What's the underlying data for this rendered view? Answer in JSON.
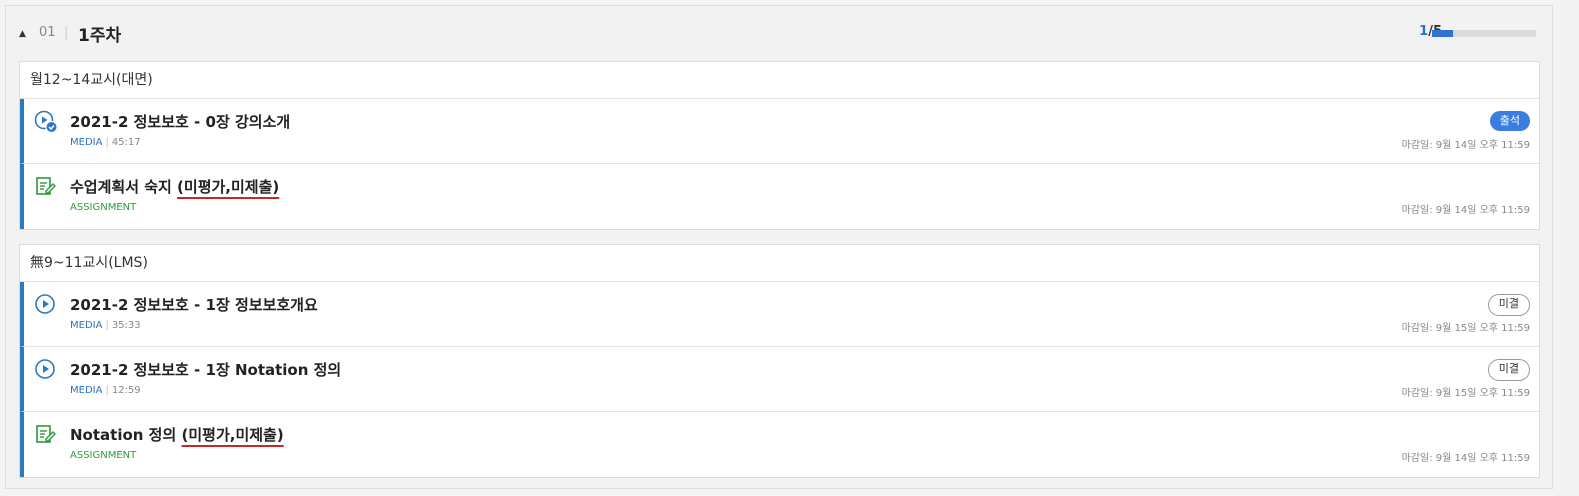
{
  "week": {
    "number": "01",
    "title": "1주차",
    "progress_current": "1",
    "progress_total": "/5",
    "progress_fraction": 0.2,
    "accent_color": "#2f74d0"
  },
  "sections": [
    {
      "title": "월12~14교시(대면)",
      "items": [
        {
          "icon": "play-check-icon",
          "title": "2021-2 정보보호 - 0장 강의소개",
          "title_marked": "",
          "type": "MEDIA",
          "duration": "45:17",
          "badge": "출석",
          "badge_style": "present",
          "deadline": "마감일: 9월 14일 오후 11:59"
        },
        {
          "icon": "assignment-icon",
          "title": "수업계획서 숙지 ",
          "title_marked": "(미평가,미제출)",
          "type": "ASSIGNMENT",
          "duration": "",
          "badge": "",
          "badge_style": "",
          "deadline": "마감일: 9월 14일 오후 11:59"
        }
      ]
    },
    {
      "title": "無9~11교시(LMS)",
      "items": [
        {
          "icon": "play-icon",
          "title": "2021-2 정보보호 - 1장 정보보호개요",
          "title_marked": "",
          "type": "MEDIA",
          "duration": "35:33",
          "badge": "미결",
          "badge_style": "absent",
          "deadline": "마감일: 9월 15일 오후 11:59"
        },
        {
          "icon": "play-icon",
          "title": "2021-2 정보보호 - 1장 Notation 정의",
          "title_marked": "",
          "type": "MEDIA",
          "duration": "12:59",
          "badge": "미결",
          "badge_style": "absent",
          "deadline": "마감일: 9월 15일 오후 11:59"
        },
        {
          "icon": "assignment-icon",
          "title": "Notation 정의 ",
          "title_marked": "(미평가,미제출)",
          "type": "ASSIGNMENT",
          "duration": "",
          "badge": "",
          "badge_style": "",
          "deadline": "마감일: 9월 14일 오후 11:59"
        }
      ]
    }
  ]
}
